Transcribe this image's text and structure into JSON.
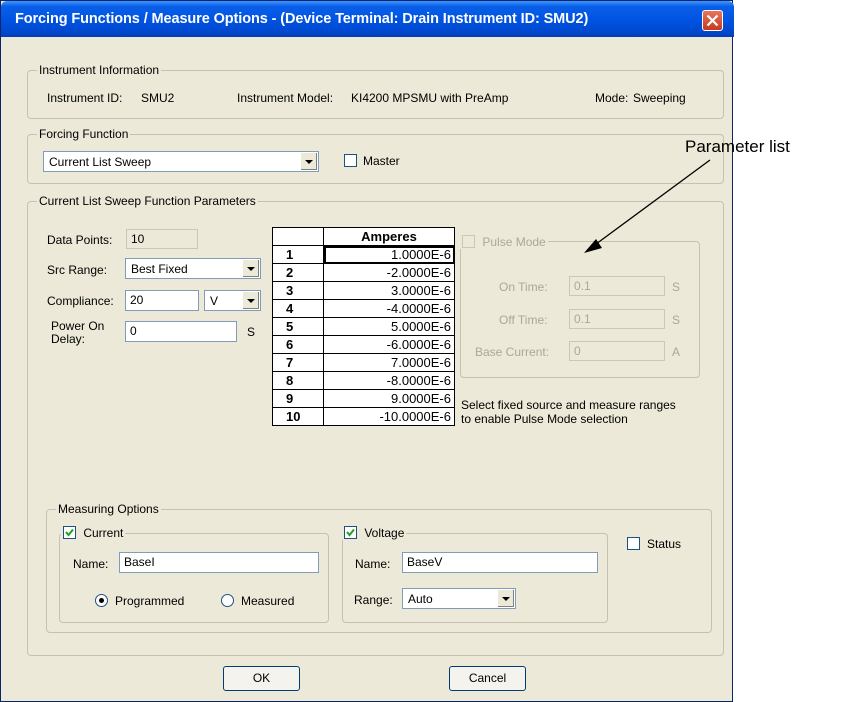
{
  "window": {
    "title": "Forcing Functions / Measure Options - (Device Terminal: Drain  Instrument ID: SMU2)"
  },
  "instrument_info": {
    "legend": "Instrument Information",
    "id_label": "Instrument ID:",
    "id_value": "SMU2",
    "model_label": "Instrument Model:",
    "model_value": "KI4200 MPSMU with PreAmp",
    "mode_label": "Mode:",
    "mode_value": "Sweeping"
  },
  "forcing_function": {
    "legend": "Forcing Function",
    "selected": "Current List Sweep",
    "master_label": "Master",
    "master_checked": false
  },
  "sweep_params": {
    "legend": "Current List Sweep Function Parameters",
    "data_points_label": "Data Points:",
    "data_points_value": "10",
    "src_range_label": "Src Range:",
    "src_range_value": "Best Fixed",
    "compliance_label": "Compliance:",
    "compliance_value": "20",
    "compliance_unit": "V",
    "power_on_label_1": "Power On",
    "power_on_label_2": "Delay:",
    "power_on_value": "0",
    "power_on_unit": "S"
  },
  "list_table": {
    "header": "Amperes",
    "rows": [
      {
        "n": "1",
        "v": "1.0000E-6"
      },
      {
        "n": "2",
        "v": "-2.0000E-6"
      },
      {
        "n": "3",
        "v": "3.0000E-6"
      },
      {
        "n": "4",
        "v": "-4.0000E-6"
      },
      {
        "n": "5",
        "v": "5.0000E-6"
      },
      {
        "n": "6",
        "v": "-6.0000E-6"
      },
      {
        "n": "7",
        "v": "7.0000E-6"
      },
      {
        "n": "8",
        "v": "-8.0000E-6"
      },
      {
        "n": "9",
        "v": "9.0000E-6"
      },
      {
        "n": "10",
        "v": "-10.0000E-6"
      }
    ]
  },
  "pulse": {
    "label": "Pulse Mode",
    "checked": false,
    "on_time_label": "On Time:",
    "on_time_value": "0.1",
    "on_time_unit": "S",
    "off_time_label": "Off Time:",
    "off_time_value": "0.1",
    "off_time_unit": "S",
    "base_current_label": "Base Current:",
    "base_current_value": "0",
    "base_current_unit": "A",
    "note_line1": "Select fixed source and measure ranges",
    "note_line2": "to enable Pulse Mode selection"
  },
  "measuring": {
    "legend": "Measuring Options",
    "current_label": "Current",
    "current_checked": true,
    "current_name_label": "Name:",
    "current_name_value": "BaseI",
    "programmed_label": "Programmed",
    "measured_label": "Measured",
    "selected_mode": "Programmed",
    "voltage_label": "Voltage",
    "voltage_checked": true,
    "voltage_name_label": "Name:",
    "voltage_name_value": "BaseV",
    "range_label": "Range:",
    "range_value": "Auto",
    "status_label": "Status",
    "status_checked": false
  },
  "buttons": {
    "ok": "OK",
    "cancel": "Cancel"
  },
  "annotation": {
    "text": "Parameter list"
  },
  "colors": {
    "titlebar": "#0054e3",
    "dialog_bg": "#ece9d8",
    "close_button": "#d8492b",
    "field_border": "#7f9db9"
  }
}
